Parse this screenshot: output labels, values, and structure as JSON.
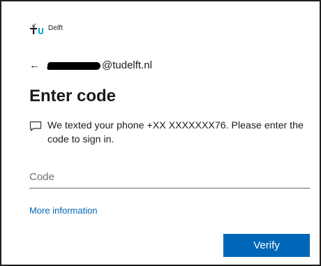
{
  "brand": {
    "logo_text": "Delft",
    "logo_mark": "TU",
    "accent_color": "#00a6d6"
  },
  "identity": {
    "back_icon": "arrow-left-icon",
    "email": "@tudelft.nl"
  },
  "page": {
    "title": "Enter code",
    "message_icon": "chat-bubble-icon",
    "message": "We texted your phone +XX XXXXXXX76. Please enter the code to sign in."
  },
  "form": {
    "code_placeholder": "Code",
    "code_value": ""
  },
  "links": {
    "more_info": "More information"
  },
  "actions": {
    "verify_label": "Verify",
    "verify_color": "#0067b8"
  }
}
